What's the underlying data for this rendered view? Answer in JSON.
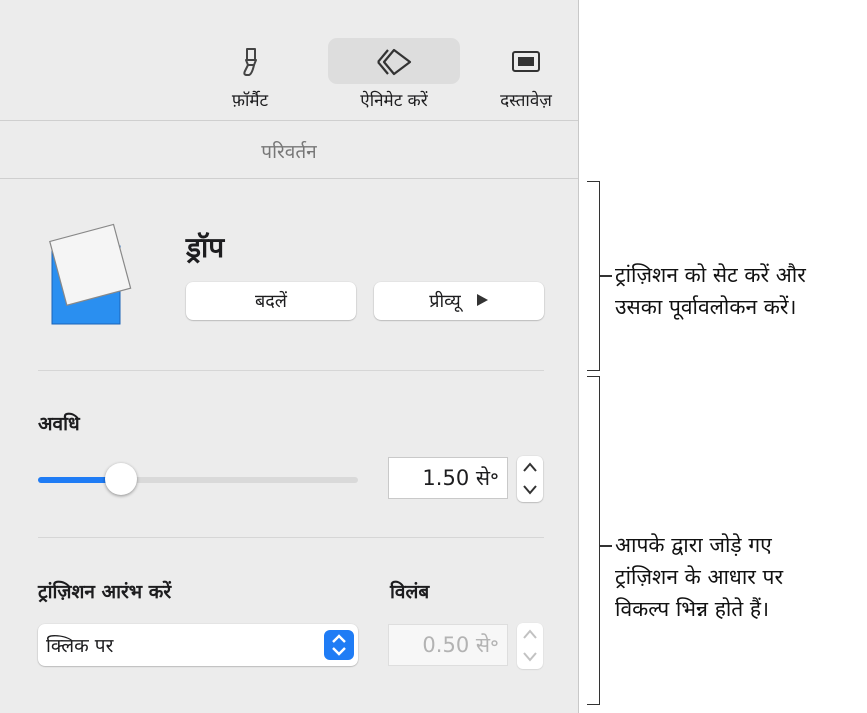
{
  "toolbar": {
    "items": [
      {
        "label": "फ़ॉर्मैट",
        "icon": "paintbrush-icon"
      },
      {
        "label": "ऐनिमेट करें",
        "icon": "diamond-animate-icon",
        "active": true
      },
      {
        "label": "दस्तावेज़",
        "icon": "document-icon"
      }
    ]
  },
  "section_title": "परिवर्तन",
  "transition": {
    "name": "ड्रॉप",
    "change_label": "बदलें",
    "preview_label": "प्रीव्यू"
  },
  "duration": {
    "label": "अवधि",
    "value": "1.50 से॰",
    "slider_fraction": 0.26
  },
  "start_transition": {
    "label": "ट्रांज़िशन आरंभ करें",
    "selected": "क्लिक पर"
  },
  "delay": {
    "label": "विलंब",
    "value": "0.50 से॰"
  },
  "callouts": {
    "top": [
      "ट्रांज़िशन को सेट करें और",
      "उसका पूर्वावलोकन करें।"
    ],
    "bottom": [
      "आपके द्वारा जोड़े गए",
      "ट्रांज़िशन के आधार पर",
      "विकल्प भिन्न होते हैं।"
    ]
  },
  "colors": {
    "accent": "#1f7cf5",
    "thumbnail_blue": "#2a8ff0"
  }
}
